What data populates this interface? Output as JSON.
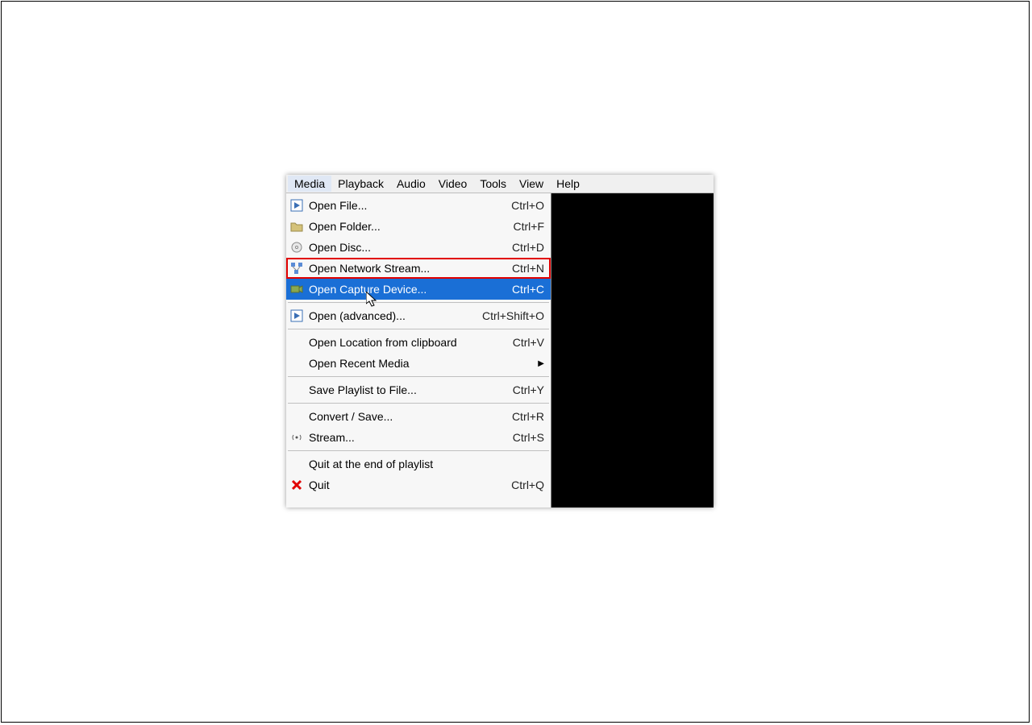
{
  "menubar": {
    "items": [
      {
        "label": "Media"
      },
      {
        "label": "Playback"
      },
      {
        "label": "Audio"
      },
      {
        "label": "Video"
      },
      {
        "label": "Tools"
      },
      {
        "label": "View"
      },
      {
        "label": "Help"
      }
    ],
    "active_index": 0
  },
  "media_menu": {
    "groups": [
      [
        {
          "icon": "play-file-icon",
          "label": "Open File...",
          "shortcut": "Ctrl+O"
        },
        {
          "icon": "folder-icon",
          "label": "Open Folder...",
          "shortcut": "Ctrl+F"
        },
        {
          "icon": "disc-icon",
          "label": "Open Disc...",
          "shortcut": "Ctrl+D"
        },
        {
          "icon": "network-icon",
          "label": "Open Network Stream...",
          "shortcut": "Ctrl+N",
          "red_highlight": true
        },
        {
          "icon": "capture-icon",
          "label": "Open Capture Device...",
          "shortcut": "Ctrl+C",
          "selected": true
        }
      ],
      [
        {
          "icon": "play-file-icon",
          "label": "Open (advanced)...",
          "shortcut": "Ctrl+Shift+O"
        }
      ],
      [
        {
          "icon": null,
          "label": "Open Location from clipboard",
          "shortcut": "Ctrl+V"
        },
        {
          "icon": null,
          "label": "Open Recent Media",
          "submenu": true
        }
      ],
      [
        {
          "icon": null,
          "label": "Save Playlist to File...",
          "shortcut": "Ctrl+Y"
        }
      ],
      [
        {
          "icon": null,
          "label": "Convert / Save...",
          "shortcut": "Ctrl+R"
        },
        {
          "icon": "stream-icon",
          "label": "Stream...",
          "shortcut": "Ctrl+S"
        }
      ],
      [
        {
          "icon": null,
          "label": "Quit at the end of playlist"
        },
        {
          "icon": "quit-icon",
          "label": "Quit",
          "shortcut": "Ctrl+Q"
        }
      ]
    ]
  }
}
